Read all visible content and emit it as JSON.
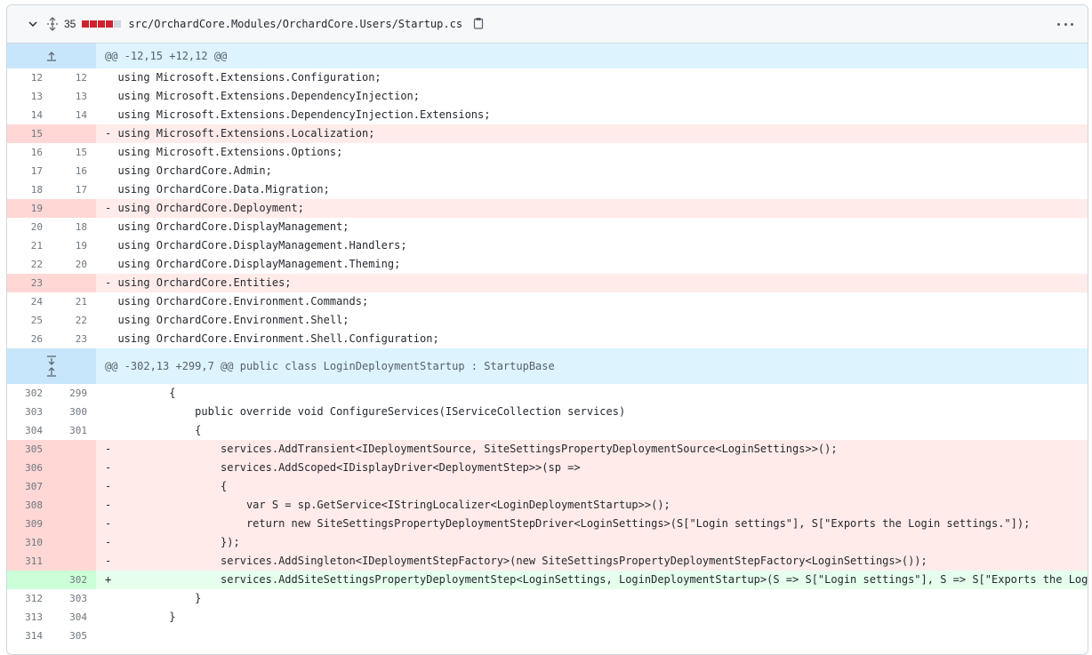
{
  "header": {
    "change_count": "35",
    "path": "src/OrchardCore.Modules/OrchardCore.Users/Startup.cs"
  },
  "hunks": [
    {
      "text": "@@ -12,15 +12,12 @@"
    },
    {
      "text": "@@ -302,13 +299,7 @@ public class LoginDeploymentStartup : StartupBase"
    }
  ],
  "lines1": [
    {
      "old": "12",
      "new": "12",
      "type": "ctx",
      "code": "  using Microsoft.Extensions.Configuration;"
    },
    {
      "old": "13",
      "new": "13",
      "type": "ctx",
      "code": "  using Microsoft.Extensions.DependencyInjection;"
    },
    {
      "old": "14",
      "new": "14",
      "type": "ctx",
      "code": "  using Microsoft.Extensions.DependencyInjection.Extensions;"
    },
    {
      "old": "15",
      "new": "",
      "type": "del",
      "code": "- using Microsoft.Extensions.Localization;"
    },
    {
      "old": "16",
      "new": "15",
      "type": "ctx",
      "code": "  using Microsoft.Extensions.Options;"
    },
    {
      "old": "17",
      "new": "16",
      "type": "ctx",
      "code": "  using OrchardCore.Admin;"
    },
    {
      "old": "18",
      "new": "17",
      "type": "ctx",
      "code": "  using OrchardCore.Data.Migration;"
    },
    {
      "old": "19",
      "new": "",
      "type": "del",
      "code": "- using OrchardCore.Deployment;"
    },
    {
      "old": "20",
      "new": "18",
      "type": "ctx",
      "code": "  using OrchardCore.DisplayManagement;"
    },
    {
      "old": "21",
      "new": "19",
      "type": "ctx",
      "code": "  using OrchardCore.DisplayManagement.Handlers;"
    },
    {
      "old": "22",
      "new": "20",
      "type": "ctx",
      "code": "  using OrchardCore.DisplayManagement.Theming;"
    },
    {
      "old": "23",
      "new": "",
      "type": "del",
      "code": "- using OrchardCore.Entities;"
    },
    {
      "old": "24",
      "new": "21",
      "type": "ctx",
      "code": "  using OrchardCore.Environment.Commands;"
    },
    {
      "old": "25",
      "new": "22",
      "type": "ctx",
      "code": "  using OrchardCore.Environment.Shell;"
    },
    {
      "old": "26",
      "new": "23",
      "type": "ctx",
      "code": "  using OrchardCore.Environment.Shell.Configuration;"
    }
  ],
  "lines2": [
    {
      "old": "302",
      "new": "299",
      "type": "ctx",
      "code": "          {"
    },
    {
      "old": "303",
      "new": "300",
      "type": "ctx",
      "code": "              public override void ConfigureServices(IServiceCollection services)"
    },
    {
      "old": "304",
      "new": "301",
      "type": "ctx",
      "code": "              {"
    },
    {
      "old": "305",
      "new": "",
      "type": "del",
      "code": "-                 services.AddTransient<IDeploymentSource, SiteSettingsPropertyDeploymentSource<LoginSettings>>();"
    },
    {
      "old": "306",
      "new": "",
      "type": "del",
      "code": "-                 services.AddScoped<IDisplayDriver<DeploymentStep>>(sp =>"
    },
    {
      "old": "307",
      "new": "",
      "type": "del",
      "code": "-                 {"
    },
    {
      "old": "308",
      "new": "",
      "type": "del",
      "code": "-                     var S = sp.GetService<IStringLocalizer<LoginDeploymentStartup>>();"
    },
    {
      "old": "309",
      "new": "",
      "type": "del",
      "code": "-                     return new SiteSettingsPropertyDeploymentStepDriver<LoginSettings>(S[\"Login settings\"], S[\"Exports the Login settings.\"]);"
    },
    {
      "old": "310",
      "new": "",
      "type": "del",
      "code": "-                 });"
    },
    {
      "old": "311",
      "new": "",
      "type": "del",
      "code": "-                 services.AddSingleton<IDeploymentStepFactory>(new SiteSettingsPropertyDeploymentStepFactory<LoginSettings>());"
    },
    {
      "old": "",
      "new": "302",
      "type": "add",
      "code": "+                 services.AddSiteSettingsPropertyDeploymentStep<LoginSettings, LoginDeploymentStartup>(S => S[\"Login settings\"], S => S[\"Exports the Login settings.\"]);"
    },
    {
      "old": "312",
      "new": "303",
      "type": "ctx",
      "code": "              }"
    },
    {
      "old": "313",
      "new": "304",
      "type": "ctx",
      "code": "          }"
    },
    {
      "old": "314",
      "new": "305",
      "type": "ctx",
      "code": ""
    }
  ]
}
